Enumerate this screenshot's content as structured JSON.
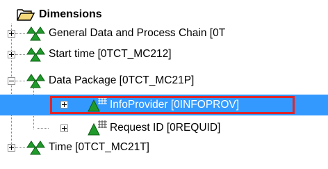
{
  "tree": {
    "root": {
      "label": "Dimensions",
      "icon": "folder-open-icon"
    },
    "items": [
      {
        "label": "General Data and Process Chain [0T",
        "level": 1,
        "expanded": false,
        "icon": "dimension-icon"
      },
      {
        "label": "Start time [0TCT_MC212]",
        "level": 1,
        "expanded": false,
        "icon": "dimension-icon"
      },
      {
        "label": "Data Package [0TCT_MC21P]",
        "level": 1,
        "expanded": true,
        "icon": "dimension-icon"
      },
      {
        "label": "InfoProvider [0INFOPROV]",
        "level": 2,
        "expanded": false,
        "selected": true,
        "icon": "characteristic-icon"
      },
      {
        "label": "Request ID [0REQUID]",
        "level": 2,
        "expanded": false,
        "icon": "characteristic-icon"
      },
      {
        "label": "Time [0TCT_MC21T]",
        "level": 1,
        "expanded": false,
        "icon": "dimension-icon"
      }
    ]
  },
  "colors": {
    "selection": "#3399ff",
    "highlight_border": "#e0242a",
    "icon_green": "#1f9a2b"
  }
}
